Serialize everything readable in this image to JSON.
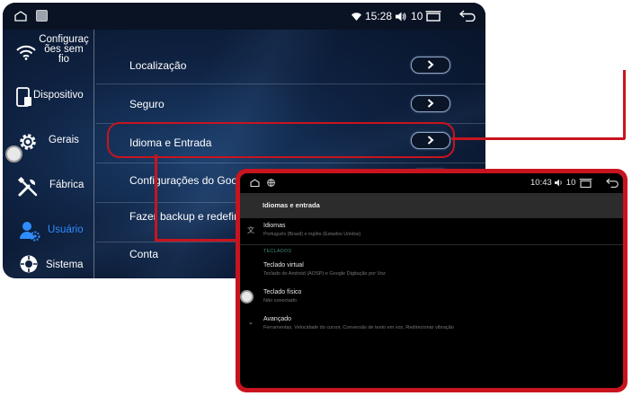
{
  "status_bar": {
    "time": "15:28",
    "volume": "10"
  },
  "sidebar": {
    "items": [
      {
        "label": "Configuraç ões sem fio",
        "icon": "wifi-icon"
      },
      {
        "label": "Dispositivo",
        "icon": "device-icon"
      },
      {
        "label": "Gerais",
        "icon": "gear-icon"
      },
      {
        "label": "Fábrica",
        "icon": "tools-icon"
      },
      {
        "label": "Usuário",
        "icon": "user-icon"
      },
      {
        "label": "Sistema",
        "icon": "system-icon"
      }
    ]
  },
  "settings": {
    "rows": [
      {
        "label": "Localização"
      },
      {
        "label": "Seguro"
      },
      {
        "label": "Idioma e Entrada"
      },
      {
        "label": "Configurações do Google"
      },
      {
        "label": "Fazer backup e redefinir"
      },
      {
        "label": "Conta"
      }
    ]
  },
  "overlay": {
    "status": {
      "time": "10:43",
      "volume": "10"
    },
    "title": "Idiomas e entrada",
    "languages": {
      "title": "Idiomas",
      "subtitle": "Português (Brasil) e inglês (Estados Unidos)"
    },
    "section_header": "TECLADOS",
    "virtual_keyboard": {
      "title": "Teclado virtual",
      "subtitle": "Teclado do Android (AOSP) e Google Digitação por Voz"
    },
    "physical_keyboard": {
      "title": "Teclado físico",
      "subtitle": "Não conectado"
    },
    "advanced": {
      "title": "Avançado",
      "subtitle": "Ferramentas, Velocidade do cursor, Conversão de texto em voz, Redirecionar vibração"
    }
  },
  "colors": {
    "highlight": "#c8141e",
    "active_sidebar": "#2f8dff",
    "section_header": "#3d8a7a"
  }
}
